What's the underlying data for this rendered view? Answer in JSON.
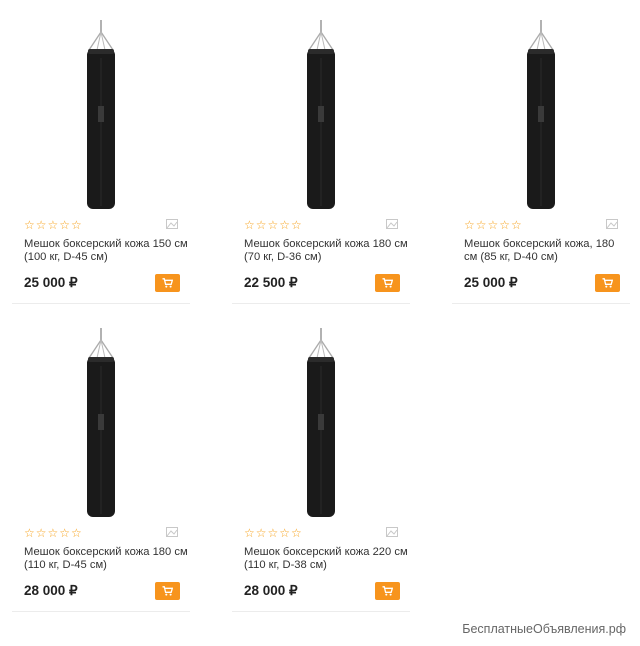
{
  "accent_color": "#f7941d",
  "star_color": "#f7a21b",
  "products": [
    {
      "title": "Мешок боксерский кожа 150 см (100 кг, D-45 см)",
      "price": "25 000 ₽",
      "stars": "☆☆☆☆☆",
      "image_icon": "punching-bag-icon",
      "compare_icon": "compare-icon",
      "cart_icon": "cart-icon"
    },
    {
      "title": "Мешок боксерский кожа 180 см (70 кг, D-36 см)",
      "price": "22 500 ₽",
      "stars": "☆☆☆☆☆",
      "image_icon": "punching-bag-icon",
      "compare_icon": "compare-icon",
      "cart_icon": "cart-icon"
    },
    {
      "title": "Мешок боксерский кожа, 180 см (85 кг, D-40 см)",
      "price": "25 000 ₽",
      "stars": "☆☆☆☆☆",
      "image_icon": "punching-bag-icon",
      "compare_icon": "compare-icon",
      "cart_icon": "cart-icon"
    },
    {
      "title": "Мешок боксерский кожа 180 см (110 кг, D-45 см)",
      "price": "28 000 ₽",
      "stars": "☆☆☆☆☆",
      "image_icon": "punching-bag-icon",
      "compare_icon": "compare-icon",
      "cart_icon": "cart-icon"
    },
    {
      "title": "Мешок боксерский кожа 220 см (110 кг, D-38 см)",
      "price": "28 000 ₽",
      "stars": "☆☆☆☆☆",
      "image_icon": "punching-bag-icon",
      "compare_icon": "compare-icon",
      "cart_icon": "cart-icon"
    }
  ],
  "watermark": "БесплатныеОбъявления.рф"
}
